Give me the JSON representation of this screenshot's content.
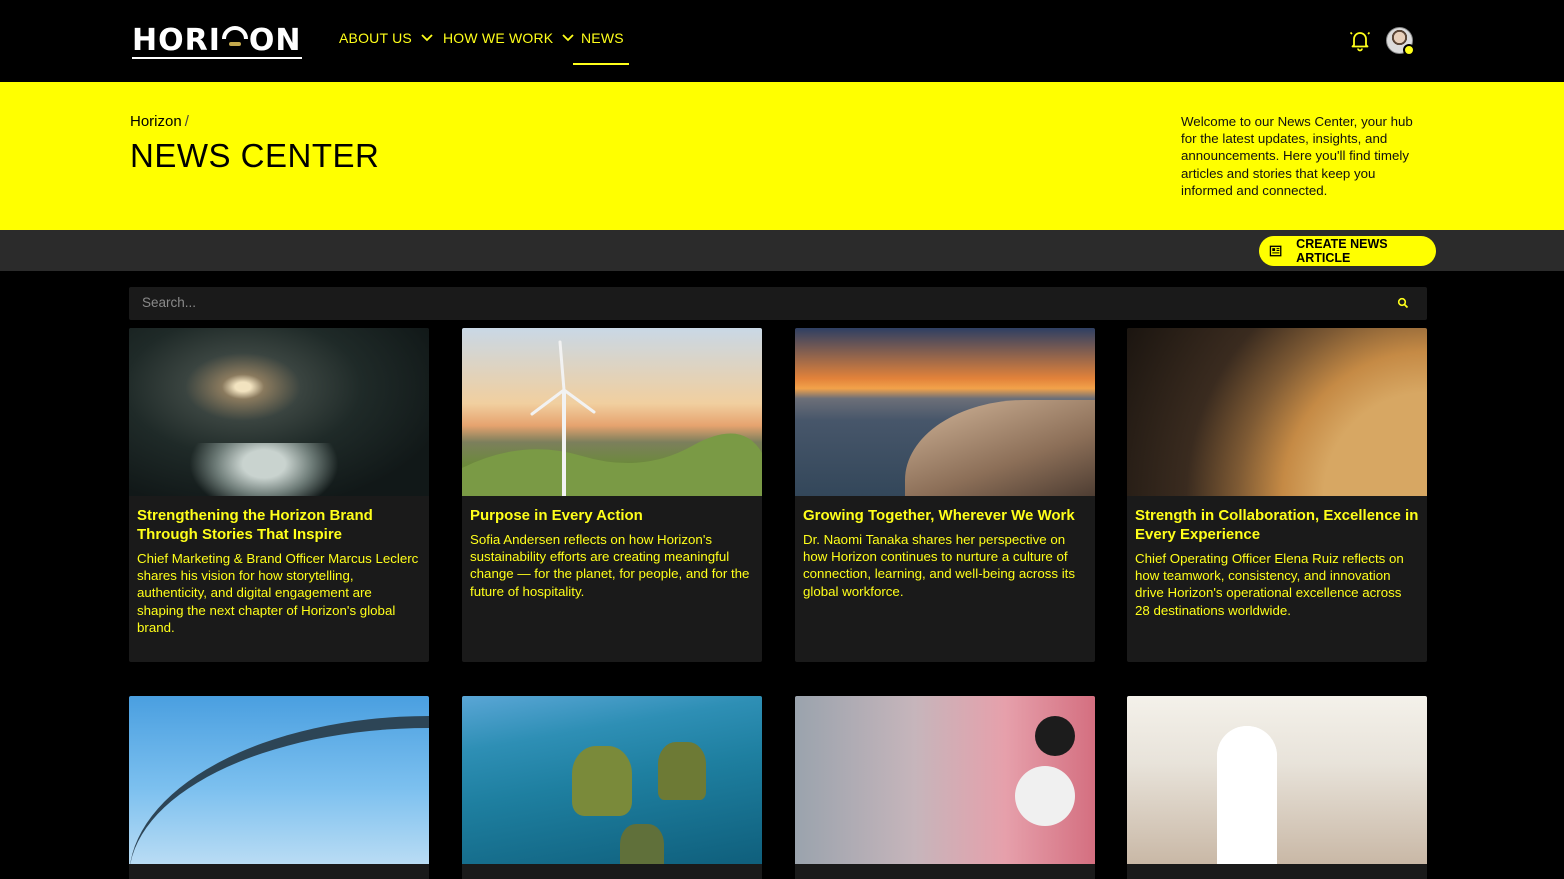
{
  "brand": {
    "logo_text": "HORIZON"
  },
  "nav": {
    "items": [
      {
        "label": "ABOUT US",
        "has_dropdown": true
      },
      {
        "label": "HOW WE WORK",
        "has_dropdown": true
      },
      {
        "label": "NEWS",
        "has_dropdown": false,
        "active": true
      }
    ]
  },
  "header_icons": {
    "notifications": "bell-icon",
    "profile": "avatar"
  },
  "hero": {
    "breadcrumb_root": "Horizon",
    "breadcrumb_sep": "/",
    "title": "NEWS CENTER",
    "description": "Welcome to our News Center, your hub for the latest updates, insights, and announcements. Here you'll find timely articles and stories that keep you informed and connected."
  },
  "actions": {
    "create_label": "CREATE NEWS ARTICLE"
  },
  "search": {
    "placeholder": "Search..."
  },
  "articles": [
    {
      "title": "Strengthening the Horizon Brand Through Stories That Inspire",
      "summary": "Chief Marketing & Brand Officer Marcus Leclerc shares his vision for how storytelling, authenticity, and digital engagement are shaping the next chapter of Horizon's global brand."
    },
    {
      "title": "Purpose in Every Action",
      "summary": "Sofia Andersen reflects on how Horizon's sustainability efforts are creating meaningful change — for the planet, for people, and for the future of hospitality."
    },
    {
      "title": "Growing Together, Wherever We Work",
      "summary": "Dr. Naomi Tanaka shares her perspective on how Horizon continues to nurture a culture of connection, learning, and well-being across its global workforce."
    },
    {
      "title": "Strength in Collaboration, Excellence in Every Experience",
      "summary": "Chief Operating Officer Elena Ruiz reflects on how teamwork, consistency, and innovation drive Horizon's operational excellence across 28 destinations worldwide."
    },
    {
      "title": "",
      "summary": ""
    },
    {
      "title": "",
      "summary": ""
    },
    {
      "title": "",
      "summary": ""
    },
    {
      "title": "",
      "summary": ""
    }
  ],
  "colors": {
    "accent": "#ffff00",
    "bg": "#000000",
    "card": "#1a1a1a",
    "bar": "#2b2b2b"
  }
}
